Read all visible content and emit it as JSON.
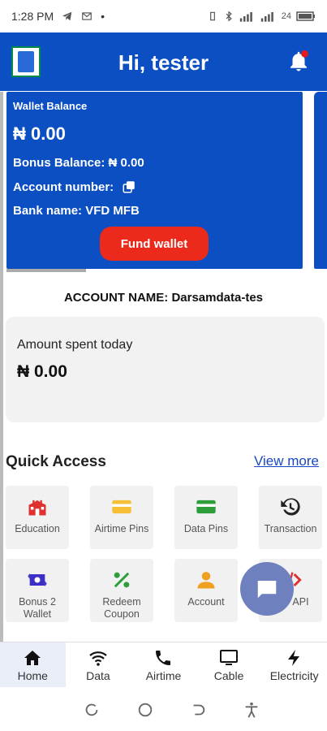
{
  "status_bar": {
    "time": "1:28 PM",
    "dot": "•",
    "battery_text": "24"
  },
  "header": {
    "greeting": "Hi, tester"
  },
  "wallet": {
    "title": "Wallet Balance",
    "balance": "₦ 0.00",
    "bonus": "Bonus Balance: ₦ 0.00",
    "account_number_label": "Account number:",
    "bank": "Bank name: VFD MFB",
    "fund_label": "Fund wallet"
  },
  "account_name": "ACCOUNT NAME: Darsamdata-tes",
  "spent": {
    "label": "Amount spent today",
    "value": "₦ 0.00"
  },
  "quick_access": {
    "title": "Quick Access",
    "view_more": "View more",
    "tiles": [
      {
        "label": "Education",
        "icon": "school-icon"
      },
      {
        "label": "Airtime Pins",
        "icon": "card-icon"
      },
      {
        "label": "Data Pins",
        "icon": "card-icon"
      },
      {
        "label": "Transaction",
        "icon": "history-icon"
      },
      {
        "label": "Bonus 2 Wallet",
        "icon": "money-exchange-icon"
      },
      {
        "label": "Redeem Coupon",
        "icon": "percent-icon"
      },
      {
        "label": "Account",
        "icon": "person-icon"
      },
      {
        "label": "Dev API",
        "icon": "code-icon"
      }
    ]
  },
  "bottom_nav": [
    {
      "label": "Home",
      "icon": "home-icon"
    },
    {
      "label": "Data",
      "icon": "wifi-icon"
    },
    {
      "label": "Airtime",
      "icon": "phone-icon"
    },
    {
      "label": "Cable",
      "icon": "monitor-icon"
    },
    {
      "label": "Electricity",
      "icon": "bolt-icon"
    }
  ],
  "colors": {
    "primary": "#0b4fc3",
    "accent": "#ec2a1c",
    "fab": "#6e80be"
  }
}
